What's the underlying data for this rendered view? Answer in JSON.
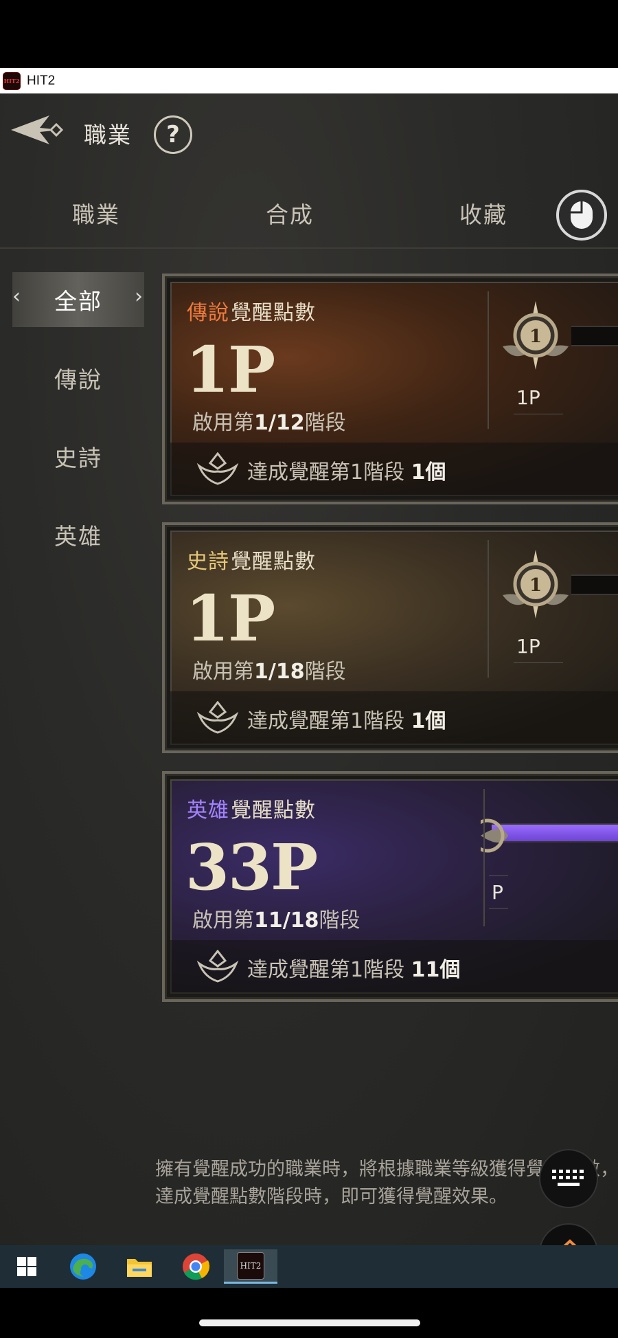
{
  "window": {
    "title": "HIT2",
    "app_icon_text": "HIT2"
  },
  "header": {
    "title": "職業",
    "help_label": "?"
  },
  "tabs": [
    {
      "label": "職業"
    },
    {
      "label": "合成"
    },
    {
      "label": "收藏"
    }
  ],
  "sidebar": {
    "items": [
      {
        "label": "全部",
        "active": true
      },
      {
        "label": "傳說"
      },
      {
        "label": "史詩"
      },
      {
        "label": "英雄"
      }
    ]
  },
  "cards": [
    {
      "tier": "傳說",
      "title_suffix": "覺醒點數",
      "points": "1P",
      "stage_prefix": "啟用第",
      "stage_value": "1/12",
      "stage_suffix": "階段",
      "foot_prefix": "達成覺醒第1階段",
      "foot_count": "1個",
      "medal_number": "1",
      "medal_label": "1P"
    },
    {
      "tier": "史詩",
      "title_suffix": "覺醒點數",
      "points": "1P",
      "stage_prefix": "啟用第",
      "stage_value": "1/18",
      "stage_suffix": "階段",
      "foot_prefix": "達成覺醒第1階段",
      "foot_count": "1個",
      "medal_number": "1",
      "medal_label": "1P"
    },
    {
      "tier": "英雄",
      "title_suffix": "覺醒點數",
      "points": "33P",
      "stage_prefix": "啟用第",
      "stage_value": "11/18",
      "stage_suffix": "階段",
      "foot_prefix": "達成覺醒第1階段",
      "foot_count": "11個",
      "medal_label": "P"
    }
  ],
  "note": {
    "line1": "擁有覺醒成功的職業時，將根據職業等級獲得覺醒點數，",
    "line2": "達成覺醒點數階段時，即可獲得覺醒效果。"
  },
  "colors": {
    "legend": "#f07b3d",
    "epic": "#e6c77a",
    "hero": "#a383ff",
    "hero_bar": "#8a5cf0"
  },
  "overlay": {
    "keyboard_icon": "keyboard-icon",
    "arrows_icon": "up-down-arrows-icon"
  },
  "taskbar": {
    "items": [
      "windows-start-icon",
      "edge-browser-icon",
      "file-explorer-icon",
      "chrome-icon",
      "hit2-app-icon"
    ],
    "active_item_label": "HIT2"
  }
}
